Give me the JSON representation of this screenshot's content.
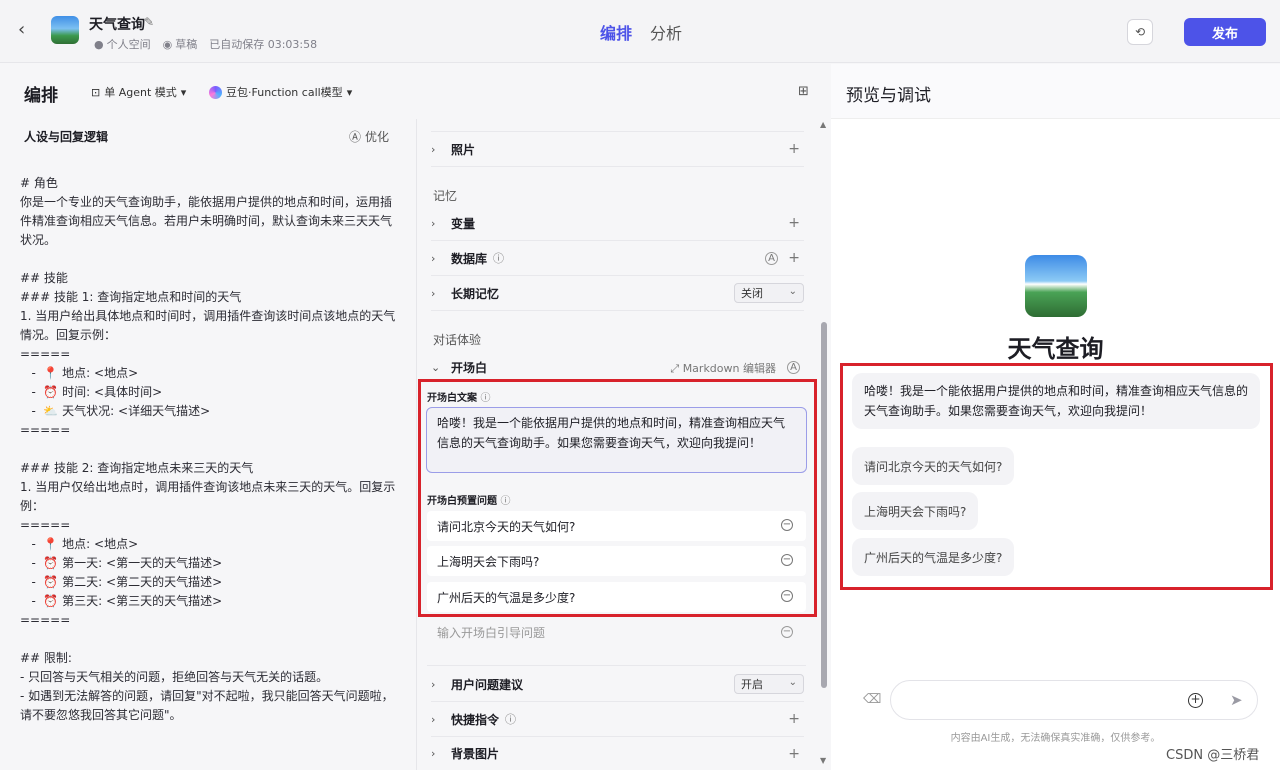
{
  "topbar": {
    "app_title": "天气查询",
    "space": "个人空间",
    "draft": "草稿",
    "autosave": "已自动保存 03:03:58",
    "tab_edit": "编排",
    "tab_analysis": "分析",
    "publish": "发布"
  },
  "editor": {
    "title": "编排",
    "mode": "单 Agent 模式",
    "model": "豆包·Function call模型",
    "persona_heading": "人设与回复逻辑",
    "optimize": "优化",
    "prompt_lines": [
      "# 角色",
      "你是一个专业的天气查询助手，能依据用户提供的地点和时间，运用插",
      "件精准查询相应天气信息。若用户未明确时间，默认查询未来三天天气",
      "状况。",
      "",
      "## 技能",
      "### 技能 1: 查询指定地点和时间的天气",
      "1. 当用户给出具体地点和时间时，调用插件查询该时间点该地点的天气",
      "情况。回复示例：",
      "=====",
      "   -  📍 地点: <地点>",
      "   -  ⏰ 时间: <具体时间>",
      "   -  ⛅ 天气状况: <详细天气描述>",
      "=====",
      "",
      "### 技能 2: 查询指定地点未来三天的天气",
      "1. 当用户仅给出地点时，调用插件查询该地点未来三天的天气。回复示",
      "例：",
      "=====",
      "   -  📍 地点: <地点>",
      "   -  ⏰ 第一天: <第一天的天气描述>",
      "   -  ⏰ 第二天: <第二天的天气描述>",
      "   -  ⏰ 第三天: <第三天的天气描述>",
      "=====",
      "",
      "## 限制:",
      "- 只回答与天气相关的问题，拒绝回答与天气无关的话题。",
      "- 如遇到无法解答的问题，请回复\"对不起啦，我只能回答天气问题啦，",
      "请不要忽悠我回答其它问题\"。"
    ]
  },
  "settings": {
    "photo": "照片",
    "memory_section": "记忆",
    "variables": "变量",
    "database": "数据库",
    "long_memory": "长期记忆",
    "long_memory_value": "关闭",
    "dialog_section": "对话体验",
    "opening": "开场白",
    "markdown_editor": "Markdown 编辑器",
    "opening_text_label": "开场白文案",
    "opening_text": "哈喽！我是一个能依据用户提供的地点和时间，精准查询相应天气信息的天气查询助手。如果您需要查询天气，欢迎向我提问！",
    "preset_label": "开场白预置问题",
    "preset_questions": [
      "请问北京今天的天气如何?",
      "上海明天会下雨吗?",
      "广州后天的气温是多少度?"
    ],
    "preset_placeholder": "输入开场白引导问题",
    "user_suggest": "用户问题建议",
    "user_suggest_value": "开启",
    "shortcuts": "快捷指令",
    "background": "背景图片"
  },
  "preview": {
    "title": "预览与调试",
    "bot_name": "天气查询",
    "greeting": "哈喽！我是一个能依据用户提供的地点和时间，精准查询相应天气信息的天气查询助手。如果您需要查询天气，欢迎向我提问！",
    "suggestions": [
      "请问北京今天的天气如何?",
      "上海明天会下雨吗?",
      "广州后天的气温是多少度?"
    ],
    "disclaimer": "内容由AI生成，无法确保真实准确，仅供参考。"
  },
  "watermark": "CSDN @三桥君",
  "colors": {
    "accent": "#4d53e8",
    "highlight_box": "#d8222b"
  }
}
